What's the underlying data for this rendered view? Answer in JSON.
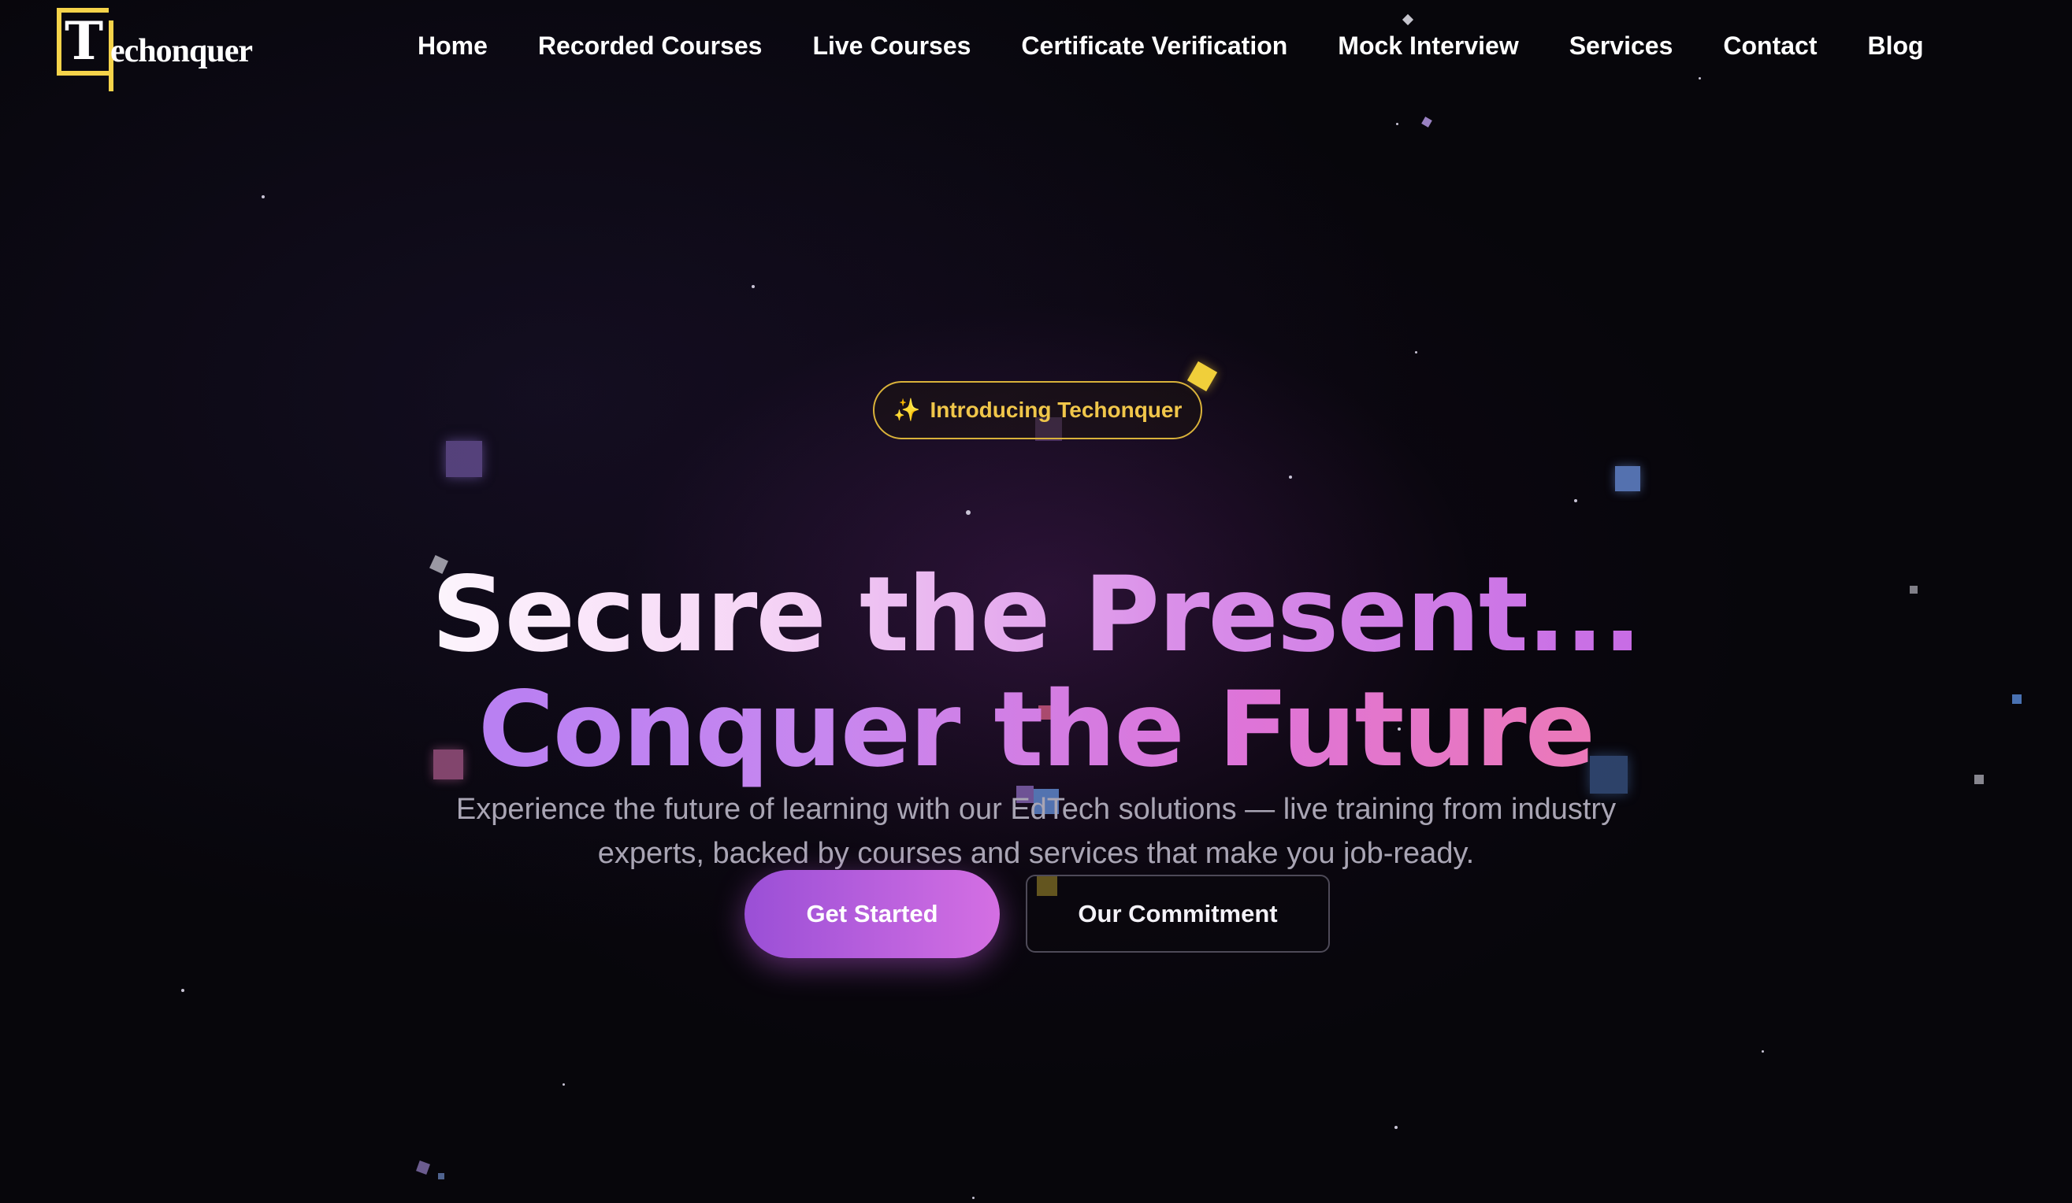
{
  "brand": {
    "logo_letter": "T",
    "logo_rest": "echonquer",
    "logo_color": "#f5d34a"
  },
  "nav": {
    "items": [
      {
        "label": "Home"
      },
      {
        "label": "Recorded Courses"
      },
      {
        "label": "Live Courses"
      },
      {
        "label": "Certificate Verification"
      },
      {
        "label": "Mock Interview"
      },
      {
        "label": "Services"
      },
      {
        "label": "Contact"
      },
      {
        "label": "Blog"
      }
    ]
  },
  "hero": {
    "badge": {
      "icon": "sparkles-icon",
      "text": "Introducing Techonquer",
      "color": "#f0c64a"
    },
    "headline_line1": "Secure the Present...",
    "headline_line2": "Conquer the Future",
    "subtitle": "Experience the future of learning with our EdTech solutions — live training from industry experts, backed by courses and services that make you job-ready.",
    "primary_button": "Get Started",
    "secondary_button": "Our Commitment"
  },
  "theme": {
    "background": "#07060b",
    "accent_purple": "#9a4fd6",
    "accent_pink": "#d46fe3"
  }
}
